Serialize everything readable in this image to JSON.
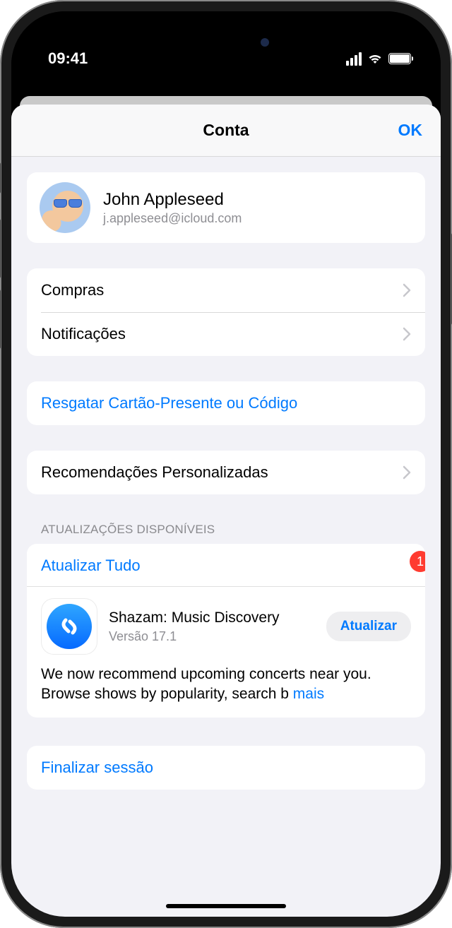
{
  "status": {
    "time": "09:41"
  },
  "sheet": {
    "title": "Conta",
    "ok": "OK"
  },
  "profile": {
    "name": "John Appleseed",
    "email": "j.appleseed@icloud.com"
  },
  "menu": {
    "purchases": "Compras",
    "notifications": "Notificações",
    "redeem": "Resgatar Cartão-Presente ou Código",
    "personalized": "Recomendações Personalizadas"
  },
  "updates": {
    "section_header": "ATUALIZAÇÕES DISPONÍVEIS",
    "update_all": "Atualizar Tudo",
    "badge_count": "1",
    "apps": [
      {
        "name": "Shazam: Music Discovery",
        "version": "Versão 17.1",
        "button": "Atualizar",
        "notes_visible": "We now recommend upcoming concerts near you. Browse shows by popularity, search b",
        "more": "mais"
      }
    ]
  },
  "signout": "Finalizar sessão"
}
